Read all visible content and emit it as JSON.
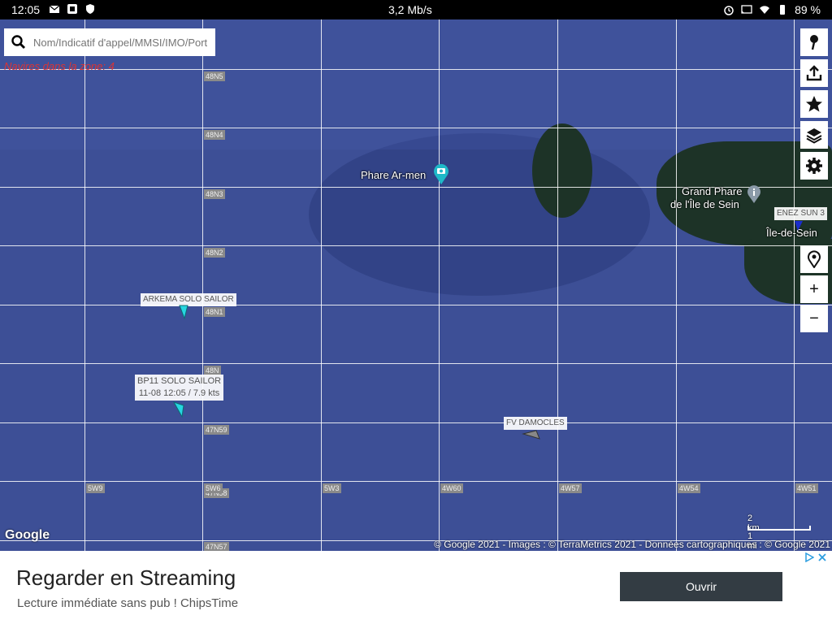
{
  "status_bar": {
    "time": "12:05",
    "network_speed": "3,2 Mb/s",
    "battery": "89 %",
    "icons": [
      "mail-icon",
      "app-icon",
      "shield-icon",
      "alarm-icon",
      "cast-icon",
      "wifi-icon",
      "battery-icon"
    ]
  },
  "search": {
    "placeholder": "Nom/Indicatif d'appel/MMSI/IMO/Port"
  },
  "vessel_count": "Navires dans la zone: 4",
  "map": {
    "lat_labels": [
      "48N5",
      "48N4",
      "48N3",
      "48N2",
      "48N1",
      "48N",
      "47N59",
      "47N58",
      "47N57"
    ],
    "lon_labels": [
      "5W9",
      "5W6",
      "5W3",
      "4W60",
      "4W57",
      "4W54",
      "4W51"
    ],
    "places": {
      "phare_ar_men": "Phare Ar-men",
      "grand_phare_line1": "Grand Phare",
      "grand_phare_line2": "de l'Île de Sein",
      "ile_de_sein": "Île-de-Sein"
    },
    "ships": {
      "arkema": "ARKEMA SOLO SAILOR",
      "bp11_name": "BP11 SOLO SAILOR",
      "bp11_info": "11-08 12:05 / 7.9 kts",
      "fv_damocles": "FV DAMOCLES",
      "enez_sun": "ENEZ SUN 3"
    },
    "google": "Google",
    "attribution": "© Google 2021 - Images : © TerraMetrics 2021 - Données cartographiques : © Google 2021",
    "scale_km": "2 km",
    "scale_mi": "1 mi"
  },
  "toolbar": {
    "pin": "pin-icon",
    "share": "share-icon",
    "star": "star-icon",
    "layers": "layers-icon",
    "settings": "gear-icon",
    "location": "location-icon",
    "zoom_in": "+",
    "zoom_out": "−"
  },
  "ad": {
    "title": "Regarder en Streaming",
    "subtitle": "Lecture immédiate sans pub ! ChipsTime",
    "button": "Ouvrir"
  },
  "colors": {
    "sea": "#3d4f96",
    "land": "#1d3327",
    "ship_cyan": "#26d6e0",
    "ad_button": "#333c43",
    "count_red": "#dd3333"
  }
}
